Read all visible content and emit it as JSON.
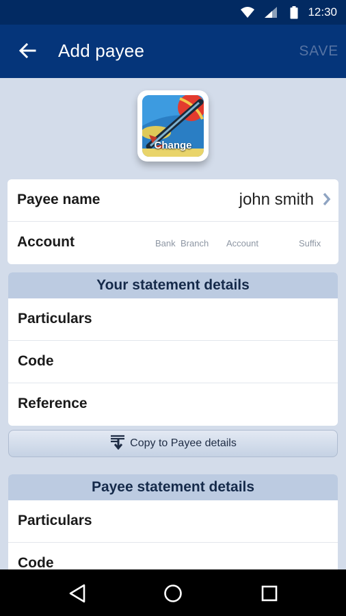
{
  "status_bar": {
    "time": "12:30",
    "icons": [
      "wifi-icon",
      "signal-icon",
      "battery-icon"
    ]
  },
  "app_bar": {
    "back_icon": "arrow-back-icon",
    "title": "Add payee",
    "save_label": "SAVE"
  },
  "avatar": {
    "change_label": "Change"
  },
  "payee": {
    "name_label": "Payee name",
    "name_value": "john smith",
    "account_label": "Account",
    "account_parts": {
      "bank": "Bank",
      "branch": "Branch",
      "account": "Account",
      "suffix": "Suffix"
    }
  },
  "your_statement": {
    "header": "Your statement details",
    "particulars": "Particulars",
    "code": "Code",
    "reference": "Reference"
  },
  "copy_button": {
    "label": "Copy to Payee details",
    "icon": "copy-down-icon"
  },
  "payee_statement": {
    "header": "Payee statement details",
    "particulars": "Particulars",
    "code": "Code"
  },
  "nav_bar": {
    "icons": [
      "back-triangle-icon",
      "home-circle-icon",
      "recents-square-icon"
    ]
  },
  "colors": {
    "status_bar": "#022a62",
    "app_bar": "#05357a",
    "background": "#d3dcea",
    "section_header": "#bccbe1",
    "save_disabled": "#5673a3"
  }
}
